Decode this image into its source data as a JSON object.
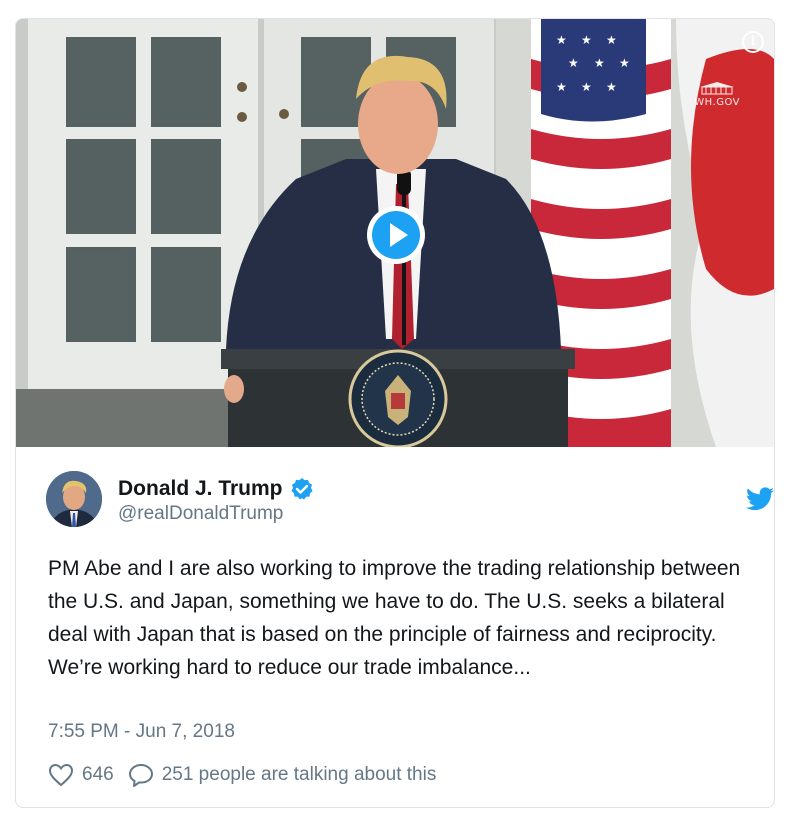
{
  "media": {
    "watermark": "WH.GOV",
    "info_glyph": "i",
    "icons": {
      "info": "info-icon",
      "play": "play-button-icon"
    }
  },
  "tweet": {
    "author_name": "Donald J. Trump",
    "handle": "@realDonaldTrump",
    "verified": true,
    "text": "PM Abe and I are also working to improve the trading relationship between the U.S. and Japan, something we have to do. The U.S. seeks a bilateral deal with Japan that is based on the principle of fairness and reciprocity. We’re working hard to reduce our trade imbalance...",
    "timestamp": "7:55 PM - Jun 7, 2018",
    "like_count": "646",
    "talking_label": "251 people are talking about this"
  },
  "icons": {
    "verified": "verified-badge-icon",
    "logo": "twitter-bird-icon",
    "like": "heart-icon",
    "reply": "speech-bubble-icon"
  },
  "colors": {
    "accent": "#1da1f2",
    "text": "#14171a",
    "muted": "#657786",
    "border": "#dfe3e8"
  }
}
